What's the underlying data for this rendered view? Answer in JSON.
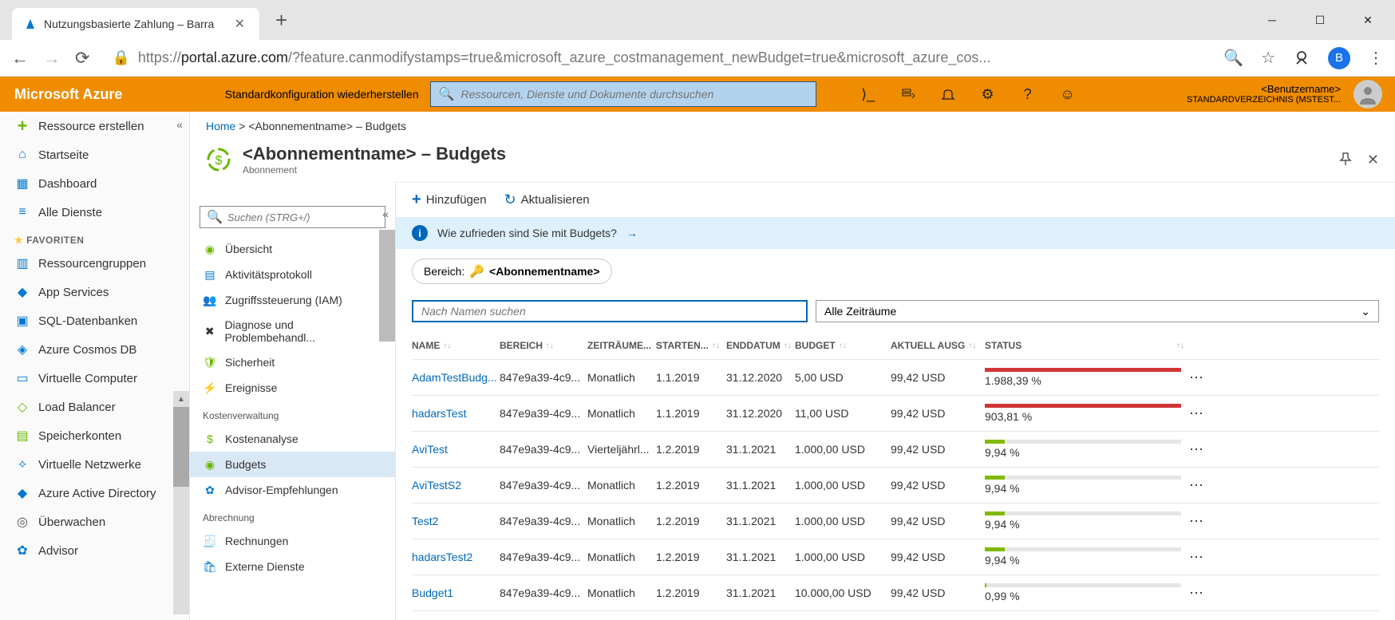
{
  "browser": {
    "tab_title": "Nutzungsbasierte Zahlung – Barra",
    "url_prefix": "https://",
    "url_host": "portal.azure.com",
    "url_path": "/?feature.canmodifystamps=true&microsoft_azure_costmanagement_newBudget=true&microsoft_azure_cos...",
    "user_initial": "B"
  },
  "azure": {
    "brand": "Microsoft Azure",
    "restore_link": "Standardkonfiguration wiederherstellen",
    "search_placeholder": "Ressourcen, Dienste und Dokumente durchsuchen",
    "username": "<Benutzername>",
    "directory": "STANDARDVERZEICHNIS (MSTEST..."
  },
  "sidebar": {
    "create": "Ressource erstellen",
    "home": "Startseite",
    "dashboard": "Dashboard",
    "all_services": "Alle Dienste",
    "favorites_header": "FAVORITEN",
    "items": [
      "Ressourcengruppen",
      "App Services",
      "SQL-Datenbanken",
      "Azure Cosmos DB",
      "Virtuelle Computer",
      "Load Balancer",
      "Speicherkonten",
      "Virtuelle Netzwerke",
      "Azure Active Directory",
      "Überwachen",
      "Advisor"
    ]
  },
  "resource_menu": {
    "search_placeholder": "Suchen (STRG+/)",
    "overview": "Übersicht",
    "activity_log": "Aktivitätsprotokoll",
    "iam": "Zugriffssteuerung (IAM)",
    "diagnose": "Diagnose und Problembehandl...",
    "security": "Sicherheit",
    "events": "Ereignisse",
    "cost_header": "Kostenverwaltung",
    "cost_analysis": "Kostenanalyse",
    "budgets": "Budgets",
    "advisor_rec": "Advisor-Empfehlungen",
    "billing_header": "Abrechnung",
    "invoices": "Rechnungen",
    "external": "Externe Dienste"
  },
  "breadcrumb": {
    "home": "Home",
    "current": "<Abonnementname> – Budgets"
  },
  "page": {
    "title": "<Abonnementname> – Budgets",
    "subtitle": "Abonnement"
  },
  "toolbar": {
    "add": "Hinzufügen",
    "refresh": "Aktualisieren"
  },
  "banner": {
    "text": "Wie zufrieden sind Sie mit Budgets?"
  },
  "scope": {
    "label": "Bereich:",
    "value": "<Abonnementname>"
  },
  "filters": {
    "name_placeholder": "Nach Namen suchen",
    "period_label": "Alle Zeiträume"
  },
  "columns": {
    "name": "NAME",
    "scope": "BEREICH",
    "period": "ZEITRÄUME...",
    "start": "STARTEN...",
    "end": "ENDDATUM",
    "budget": "BUDGET",
    "spend": "AKTUELL AUSG",
    "status": "STATUS"
  },
  "rows": [
    {
      "name": "AdamTestBudg...",
      "scope": "847e9a39-4c9...",
      "period": "Monatlich",
      "start": "1.1.2019",
      "end": "31.12.2020",
      "budget": "5,00 USD",
      "spend": "99,42 USD",
      "status": "1.988,39 %",
      "pct": 100,
      "color": "red"
    },
    {
      "name": "hadarsTest",
      "scope": "847e9a39-4c9...",
      "period": "Monatlich",
      "start": "1.1.2019",
      "end": "31.12.2020",
      "budget": "11,00 USD",
      "spend": "99,42 USD",
      "status": "903,81 %",
      "pct": 100,
      "color": "red"
    },
    {
      "name": "AviTest",
      "scope": "847e9a39-4c9...",
      "period": "Vierteljährl...",
      "start": "1.2.2019",
      "end": "31.1.2021",
      "budget": "1.000,00 USD",
      "spend": "99,42 USD",
      "status": "9,94 %",
      "pct": 10,
      "color": "green"
    },
    {
      "name": "AviTestS2",
      "scope": "847e9a39-4c9...",
      "period": "Monatlich",
      "start": "1.2.2019",
      "end": "31.1.2021",
      "budget": "1.000,00 USD",
      "spend": "99,42 USD",
      "status": "9,94 %",
      "pct": 10,
      "color": "green"
    },
    {
      "name": "Test2",
      "scope": "847e9a39-4c9...",
      "period": "Monatlich",
      "start": "1.2.2019",
      "end": "31.1.2021",
      "budget": "1.000,00 USD",
      "spend": "99,42 USD",
      "status": "9,94 %",
      "pct": 10,
      "color": "green"
    },
    {
      "name": "hadarsTest2",
      "scope": "847e9a39-4c9...",
      "period": "Monatlich",
      "start": "1.2.2019",
      "end": "31.1.2021",
      "budget": "1.000,00 USD",
      "spend": "99,42 USD",
      "status": "9,94 %",
      "pct": 10,
      "color": "green"
    },
    {
      "name": "Budget1",
      "scope": "847e9a39-4c9...",
      "period": "Monatlich",
      "start": "1.2.2019",
      "end": "31.1.2021",
      "budget": "10.000,00 USD",
      "spend": "99,42 USD",
      "status": "0,99 %",
      "pct": 1,
      "color": "green"
    }
  ]
}
